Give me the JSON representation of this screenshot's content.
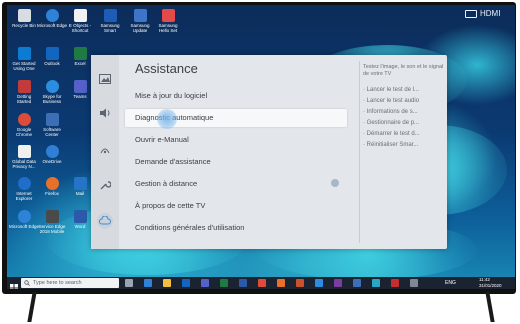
{
  "tv": {
    "input_label": "HDMI"
  },
  "desktop_icons": [
    {
      "label": "Recycle Bin",
      "color": "#d9dde2"
    },
    {
      "label": "Microsoft Edge",
      "color": "#2e83d8"
    },
    {
      "label": "E Objects - Shortcut",
      "color": "#f2f2f2"
    },
    {
      "label": "Samsung Smart",
      "color": "#1d5db5"
    },
    {
      "label": "Samsung Update",
      "color": "#3e74c9"
    },
    {
      "label": "Samsung Hello Set",
      "color": "#e44a4a"
    },
    {
      "label": "Get Started Using One",
      "color": "#0c7bd1"
    },
    {
      "label": "Outlook",
      "color": "#1266c0"
    },
    {
      "label": "Excel",
      "color": "#1f7a43"
    },
    {
      "label": "Getting Started",
      "color": "#c23b3b"
    },
    {
      "label": "Skype for Business",
      "color": "#2b8ce0"
    },
    {
      "label": "Teams",
      "color": "#5560c8"
    },
    {
      "label": "Google Chrome",
      "color": "#dd4b39"
    },
    {
      "label": "Software Center",
      "color": "#3c6fb6"
    },
    {
      "label": "Global Data Privacy N...",
      "color": "#f0f0f0"
    },
    {
      "label": "OneDrive",
      "color": "#2f7fd6"
    },
    {
      "label": "Internet Explorer",
      "color": "#1f6ec9"
    },
    {
      "label": "Firefox",
      "color": "#e8702a"
    },
    {
      "label": "Mail",
      "color": "#2475c9"
    },
    {
      "label": "Microsoft Edge",
      "color": "#2e83d8"
    },
    {
      "label": "Service Edge 2018 Mobile",
      "color": "#4a4a4a"
    },
    {
      "label": "Word",
      "color": "#2a5aa9"
    }
  ],
  "panel": {
    "title": "Assistance",
    "menu": [
      {
        "label": "Mise à jour du logiciel"
      },
      {
        "label": "Diagnostic automatique"
      },
      {
        "label": "Ouvrir e-Manual"
      },
      {
        "label": "Demande d'assistance"
      },
      {
        "label": "Gestion à distance"
      },
      {
        "label": "À propos de cette TV"
      },
      {
        "label": "Conditions générales d'utilisation"
      }
    ],
    "help_text": "Testez l'image, le son et le signal de votre TV",
    "sub_items": [
      {
        "label": "· Lancer le test de l..."
      },
      {
        "label": "· Lancer le test audio"
      },
      {
        "label": "· Informations de s..."
      },
      {
        "label": "· Gestionnaire de p..."
      },
      {
        "label": "· Démarrer le test d..."
      },
      {
        "label": "· Réinitialiser Smar..."
      }
    ]
  },
  "taskbar": {
    "search_placeholder": "Type here to search",
    "apps": [
      {
        "name": "task-view",
        "color": "#9aa4b2"
      },
      {
        "name": "edge",
        "color": "#2e83d8"
      },
      {
        "name": "file-explorer",
        "color": "#f2c03e"
      },
      {
        "name": "outlook",
        "color": "#1266c0"
      },
      {
        "name": "teams",
        "color": "#5560c8"
      },
      {
        "name": "excel",
        "color": "#1f7a43"
      },
      {
        "name": "word",
        "color": "#2a5aa9"
      },
      {
        "name": "chrome",
        "color": "#dd4b39"
      },
      {
        "name": "firefox",
        "color": "#e8702a"
      },
      {
        "name": "powerpoint",
        "color": "#c9512c"
      },
      {
        "name": "skype",
        "color": "#2b8ce0"
      },
      {
        "name": "onenote",
        "color": "#7a3ea0"
      },
      {
        "name": "calendar",
        "color": "#3c6fb6"
      },
      {
        "name": "photos",
        "color": "#2aa5c6"
      },
      {
        "name": "acrobat",
        "color": "#c52e2e"
      },
      {
        "name": "settings",
        "color": "#7f8894"
      }
    ],
    "language": "ENG",
    "time": "11:42",
    "date": "31/01/2020"
  }
}
